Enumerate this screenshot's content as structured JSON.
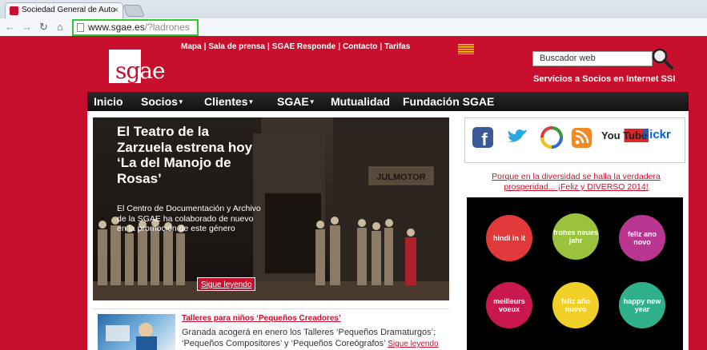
{
  "browser": {
    "tab_title": "Sociedad General de Auto",
    "tab_close": "×",
    "url_host": "www.sgae.es",
    "url_path": "/?ladrones"
  },
  "header": {
    "logo_text": "sgae",
    "top_links": [
      "Mapa",
      "Sala de prensa",
      "SGAE Responde",
      "Contacto",
      "Tarifas"
    ],
    "search_placeholder": "Buscador web",
    "ssi_link": "Servicios a Socios en Internet SSI"
  },
  "nav": {
    "items": [
      {
        "label": "Inicio",
        "dropdown": false
      },
      {
        "label": "Socios",
        "dropdown": true
      },
      {
        "label": "Clientes",
        "dropdown": true
      },
      {
        "label": "SGAE",
        "dropdown": true
      },
      {
        "label": "Mutualidad",
        "dropdown": false
      },
      {
        "label": "Fundación SGAE",
        "dropdown": false
      }
    ]
  },
  "hero": {
    "title": "El Teatro de la Zarzuela estrena hoy ‘La del Manojo de Rosas’",
    "description": "El Centro de Documentación y Archivo de la SGAE ha colaborado de nuevo en la promoción de este género",
    "sign_text": "JULMOTOR",
    "more": "Sigue leyendo"
  },
  "news": {
    "title": "Talleres para niños ‘Pequeños Creadores’",
    "text": "Granada acogerá en enero los Talleres ‘Pequeños Dramaturgos’; ‘Pequeños Compositores’ y ‘Pequeños Coreógrafos’",
    "more": "Sigue leyendo"
  },
  "social": {
    "icons": [
      "facebook-icon",
      "twitter-icon",
      "picasa-icon",
      "rss-icon",
      "youtube-icon",
      "flickr-icon"
    ],
    "youtube_text": "You Tube",
    "flickr_text": "flickr"
  },
  "promo": {
    "text": "Porque en la diversidad se halla la verdadera prosperidad... ¡Feliz y DIVERSO 2014!"
  },
  "greetings": [
    {
      "text": "hindi in it",
      "color": "#e23a3a"
    },
    {
      "text": "frohes neues jahr",
      "color": "#9ac23c"
    },
    {
      "text": "feliz ano novo",
      "color": "#b8368f"
    },
    {
      "text": "meilleurs voeux",
      "color": "#c8184e"
    },
    {
      "text": "feliz año nuevo",
      "color": "#f2d02a"
    },
    {
      "text": "happy new year",
      "color": "#2fb08a"
    }
  ],
  "colors": {
    "brand_red": "#c8102e",
    "nav_black": "#111111"
  }
}
